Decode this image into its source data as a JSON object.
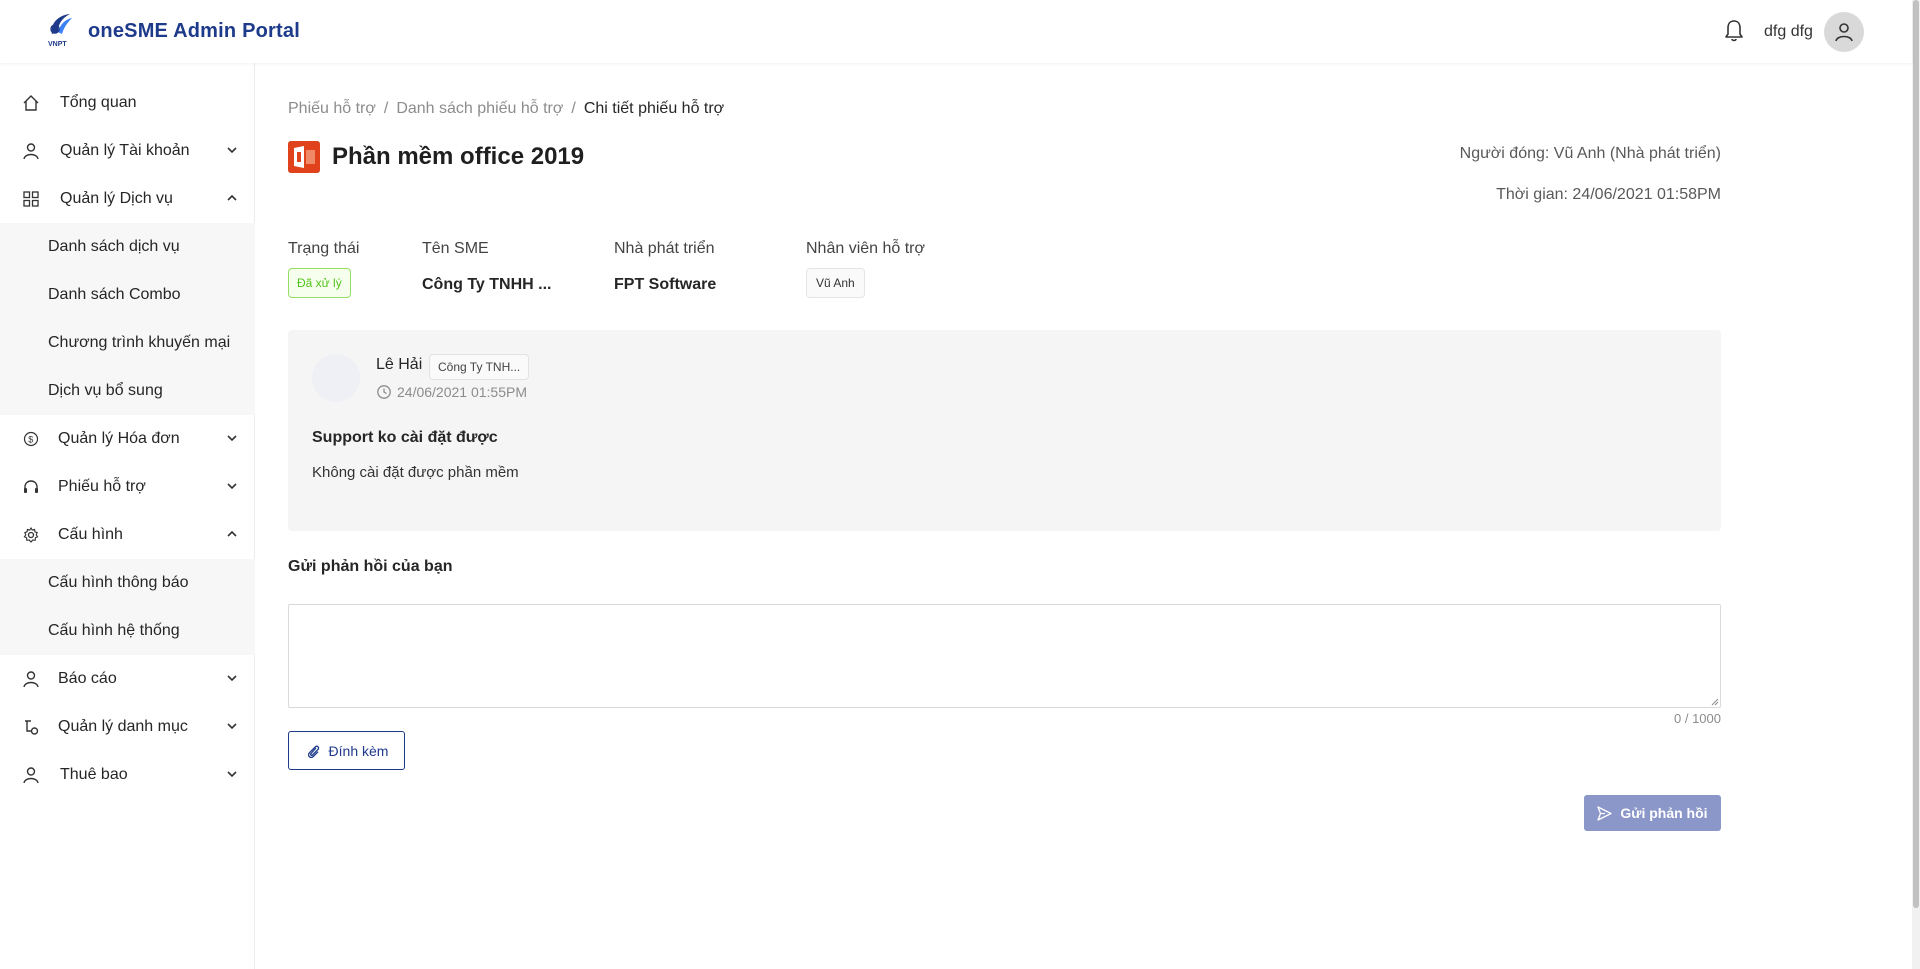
{
  "header": {
    "logo_text": "VNPT",
    "app_title": "oneSME Admin Portal",
    "user_name": "dfg dfg"
  },
  "sidebar": {
    "items": [
      {
        "label": "Tổng quan",
        "icon": "home-icon"
      },
      {
        "label": "Quản lý Tài khoản",
        "icon": "user-icon",
        "expanded": false
      },
      {
        "label": "Quản lý Dịch vụ",
        "icon": "grid-icon",
        "expanded": true,
        "children": [
          "Danh sách dịch vụ",
          "Danh sách Combo",
          "Chương trình khuyến mại",
          "Dịch vụ bổ sung"
        ]
      },
      {
        "label": "Quản lý Hóa đơn",
        "icon": "dollar-icon",
        "expanded": false
      },
      {
        "label": "Phiếu hỗ trợ",
        "icon": "headset-icon",
        "expanded": false
      },
      {
        "label": "Cấu hình",
        "icon": "gear-icon",
        "expanded": true,
        "children": [
          "Cấu hình thông báo",
          "Cấu hình hệ thống"
        ]
      },
      {
        "label": "Báo cáo",
        "icon": "user-icon",
        "expanded": false
      },
      {
        "label": "Quản lý danh mục",
        "icon": "category-icon",
        "expanded": false
      },
      {
        "label": "Thuê bao",
        "icon": "user-icon",
        "expanded": false
      }
    ]
  },
  "breadcrumb": [
    "Phiếu hỗ trợ",
    "Danh sách phiếu hỗ trợ",
    "Chi tiết phiếu hỗ trợ"
  ],
  "ticket": {
    "title": "Phần mềm office 2019",
    "closer": "Người đóng: Vũ Anh (Nhà phát triển)",
    "time": "Thời gian: 24/06/2021 01:58PM",
    "status_label": "Trạng thái",
    "status_value": "Đã xử lý",
    "sme_label": "Tên SME",
    "sme_value": "Công Ty TNHH ...",
    "dev_label": "Nhà phát triển",
    "dev_value": "FPT Software",
    "staff_label": "Nhân viên hỗ trợ",
    "staff_value": "Vũ Anh"
  },
  "message": {
    "author": "Lê Hải",
    "company": "Công Ty TNH...",
    "time": "24/06/2021 01:55PM",
    "subject": "Support ko cài đặt được",
    "body": "Không cài đặt được phần mềm"
  },
  "reply": {
    "heading": "Gửi phản hồi của bạn",
    "value": "",
    "char_count": "0 / 1000",
    "attach_label": "Đính kèm",
    "send_label": "Gửi phản hồi"
  },
  "colors": {
    "brand": "#1e3a8a",
    "status_green": "#52c41a",
    "send_button": "#8b96c9",
    "office_orange": "#e0431b"
  }
}
